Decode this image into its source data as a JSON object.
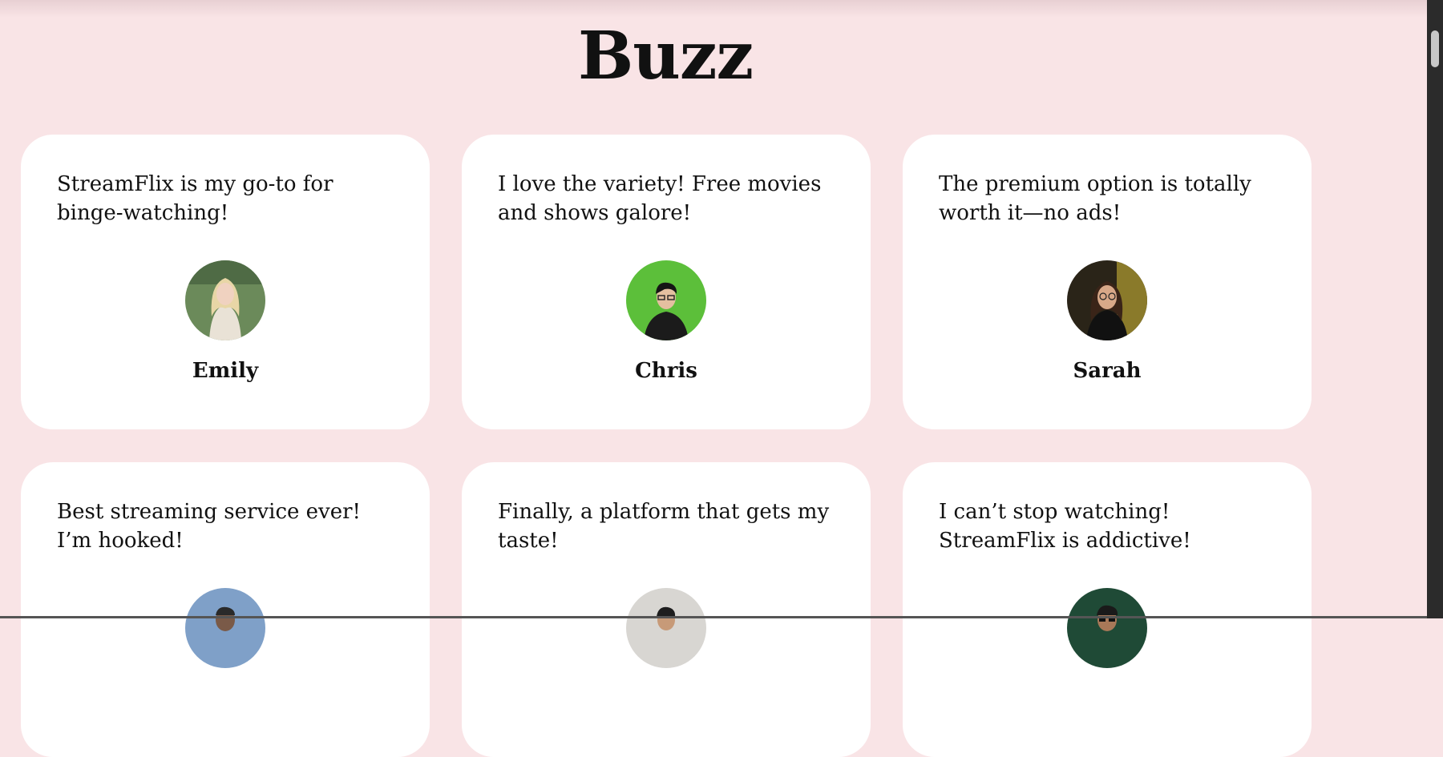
{
  "section": {
    "title": "Buzz"
  },
  "testimonials": [
    {
      "quote": "StreamFlix is my go-to for binge-watching!",
      "name": "Emily"
    },
    {
      "quote": "I love the variety! Free movies and shows galore!",
      "name": "Chris"
    },
    {
      "quote": "The premium option is totally worth it—no ads!",
      "name": "Sarah"
    },
    {
      "quote": "Best streaming service ever! I’m hooked!",
      "name": ""
    },
    {
      "quote": "Finally, a platform that gets my taste!",
      "name": ""
    },
    {
      "quote": "I can’t stop watching! StreamFlix is addictive!",
      "name": ""
    }
  ],
  "colors": {
    "background": "#f9e4e6",
    "card": "#ffffff",
    "text": "#111111"
  }
}
